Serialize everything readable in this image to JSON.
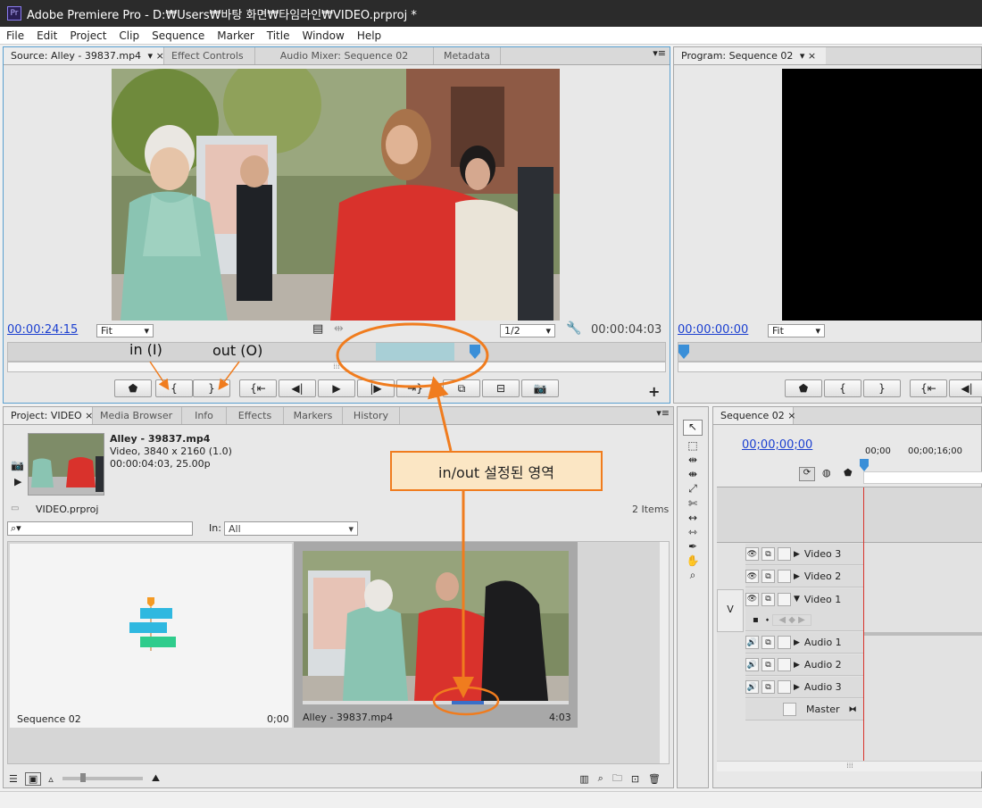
{
  "window": {
    "title": "Adobe Premiere Pro - D:₩Users₩바탕 화면₩타임라인₩VIDEO.prproj *",
    "app_icon": "Pr"
  },
  "menu": [
    "File",
    "Edit",
    "Project",
    "Clip",
    "Sequence",
    "Marker",
    "Title",
    "Window",
    "Help"
  ],
  "source_panel": {
    "tabs": [
      "Source: Alley - 39837.mp4",
      "Effect Controls",
      "Audio Mixer: Sequence 02",
      "Metadata"
    ],
    "current_time": "00:00:24:15",
    "fit": "Fit",
    "resolution": "1/2",
    "duration": "00:00:04:03",
    "in_point_fraction": 0.56,
    "out_point_fraction": 0.68,
    "playhead_fraction": 0.71
  },
  "program_panel": {
    "tab": "Program: Sequence 02",
    "current_time": "00:00:00:00",
    "fit": "Fit"
  },
  "annotations": {
    "in_label": "in (I)",
    "out_label": "out (O)",
    "callout": "in/out 설정된 영역",
    "color": "#f07c1e"
  },
  "project_panel": {
    "tabs": [
      "Project: VIDEO",
      "Media Browser",
      "Info",
      "Effects",
      "Markers",
      "History"
    ],
    "clip_name": "Alley - 39837.mp4",
    "clip_info1": "Video, 3840 x 2160 (1.0)",
    "clip_info2": "00:00:04:03, 25.00p",
    "project_file": "VIDEO.prproj",
    "item_count": "2 Items",
    "in_label": "In:",
    "in_value": "All",
    "items": [
      {
        "name": "Sequence 02",
        "duration": "0;00"
      },
      {
        "name": "Alley - 39837.mp4",
        "duration": "4:03"
      }
    ]
  },
  "sequence_panel": {
    "tab": "Sequence 02",
    "current_time": "00;00;00;00",
    "ruler": [
      "00;00",
      "00;00;16;00"
    ],
    "source_patch": "V",
    "tracks": [
      "Video 3",
      "Video 2",
      "Video 1",
      "Audio 1",
      "Audio 2",
      "Audio 3",
      "Master"
    ]
  }
}
